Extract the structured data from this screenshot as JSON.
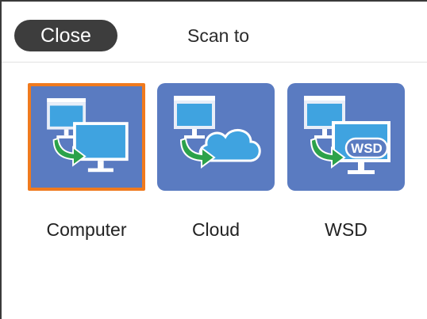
{
  "header": {
    "close_label": "Close",
    "title": "Scan to"
  },
  "options": [
    {
      "label": "Computer",
      "icon": "computer-scan-icon",
      "selected": true
    },
    {
      "label": "Cloud",
      "icon": "cloud-scan-icon",
      "selected": false
    },
    {
      "label": "WSD",
      "icon": "wsd-scan-icon",
      "selected": false,
      "badge": "WSD"
    }
  ],
  "colors": {
    "tile": "#5a7bc1",
    "selection": "#f07a1e",
    "close_button": "#3d3d3d"
  }
}
